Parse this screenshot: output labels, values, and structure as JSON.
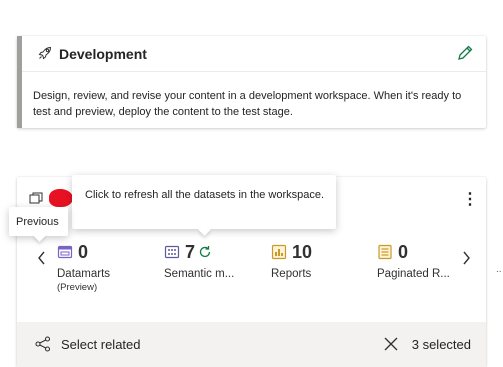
{
  "development": {
    "title": "Development",
    "description": "Design, review, and revise your content in a development workspace. When it's ready to test and preview, deploy the content to the test stage."
  },
  "tooltips": {
    "refresh": "Click to refresh all the datasets in the workspace.",
    "previous": "Previous"
  },
  "stats": [
    {
      "count": "0",
      "label": "Datamarts",
      "sub": "(Preview)",
      "icon": "datamart-icon"
    },
    {
      "count": "7",
      "label": "Semantic m...",
      "icon": "semantic-model-icon"
    },
    {
      "count": "10",
      "label": "Reports",
      "icon": "report-icon"
    },
    {
      "count": "0",
      "label": "Paginated R...",
      "icon": "paginated-report-icon"
    }
  ],
  "bottom": {
    "select_related": "Select related",
    "selected": "3 selected"
  },
  "misc": {
    "ellipsis": "..",
    "more": "⋮"
  },
  "colors": {
    "accent_gray": "#a19f9d",
    "edit_green": "#107c41",
    "datamart": "#7a62c7",
    "report": "#c79a2a",
    "avatar": "#e81123"
  }
}
